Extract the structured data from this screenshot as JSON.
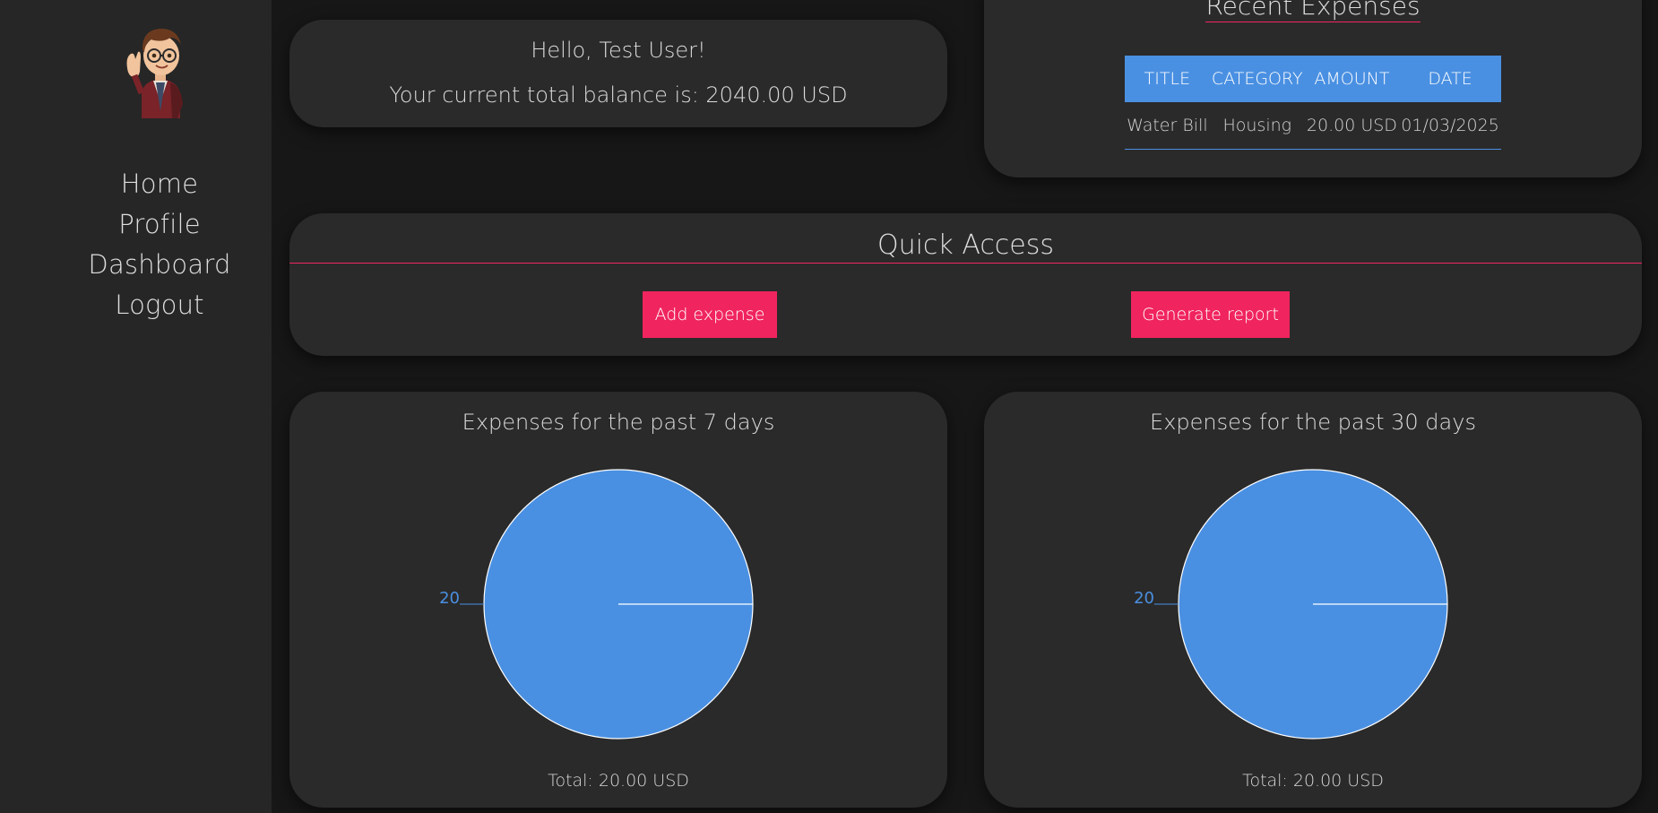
{
  "sidebar": {
    "avatar_icon": "cartoon-user-avatar-icon",
    "nav": [
      {
        "label": "Home"
      },
      {
        "label": "Profile"
      },
      {
        "label": "Dashboard"
      },
      {
        "label": "Logout"
      }
    ]
  },
  "greeting": {
    "hello": "Hello, Test User!",
    "balance": "Your current total balance is: 2040.00 USD"
  },
  "recent_expenses": {
    "title": "Recent Expenses",
    "columns": [
      "TITLE",
      "CATEGORY",
      "AMOUNT",
      "DATE"
    ],
    "rows": [
      [
        "Water Bill",
        "Housing",
        "20.00 USD",
        "01/03/2025"
      ]
    ]
  },
  "quick_access": {
    "title": "Quick Access",
    "add_label": "Add expense",
    "report_label": "Generate report"
  },
  "charts": {
    "week": {
      "title": "Expenses for the past 7 days",
      "total": "Total: 20.00 USD"
    },
    "month": {
      "title": "Expenses for the past 30 days",
      "total": "Total: 20.00 USD"
    }
  },
  "colors": {
    "accent": "#f0245e",
    "chart_blue": "#4a90e2",
    "card_bg": "#2a2a2a",
    "sidebar_bg": "#262626",
    "page_bg": "#171717"
  },
  "chart_data": [
    {
      "type": "pie",
      "title": "Expenses for the past 7 days",
      "values": [
        20
      ],
      "labels": [
        "20"
      ],
      "colors": [
        "#4a90e2"
      ]
    },
    {
      "type": "pie",
      "title": "Expenses for the past 30 days",
      "values": [
        20
      ],
      "labels": [
        "20"
      ],
      "colors": [
        "#4a90e2"
      ]
    }
  ]
}
